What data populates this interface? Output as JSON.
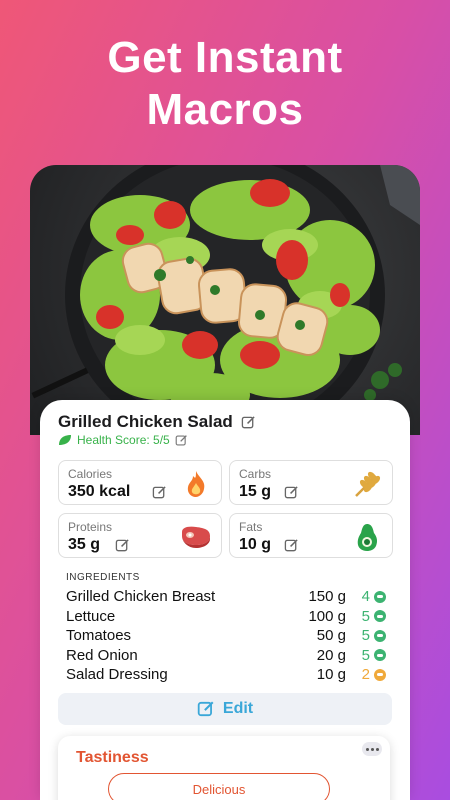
{
  "headline": {
    "line1": "Get Instant",
    "line2": "Macros"
  },
  "dish": {
    "name": "Grilled Chicken Salad",
    "health_score": "Health Score: 5/5"
  },
  "macros": [
    {
      "label": "Calories",
      "value": "350 kcal",
      "icon": "flame-icon"
    },
    {
      "label": "Carbs",
      "value": "15 g",
      "icon": "wheat-icon"
    },
    {
      "label": "Proteins",
      "value": "35 g",
      "icon": "steak-icon"
    },
    {
      "label": "Fats",
      "value": "10 g",
      "icon": "avocado-icon"
    }
  ],
  "ingredients": {
    "title": "INGREDIENTS",
    "items": [
      {
        "name": "Grilled Chicken Breast",
        "amount": "150 g",
        "score": "4",
        "color": "#3cb371"
      },
      {
        "name": "Lettuce",
        "amount": "100 g",
        "score": "5",
        "color": "#3cb371"
      },
      {
        "name": "Tomatoes",
        "amount": "50 g",
        "score": "5",
        "color": "#3cb371"
      },
      {
        "name": "Red Onion",
        "amount": "20 g",
        "score": "5",
        "color": "#3cb371"
      },
      {
        "name": "Salad Dressing",
        "amount": "10 g",
        "score": "2",
        "color": "#f0a93a"
      }
    ]
  },
  "edit_button": {
    "label": "Edit"
  },
  "tastiness": {
    "title": "Tastiness",
    "selected": "Delicious"
  },
  "colors": {
    "accent_blue": "#3aa7d8",
    "health_green": "#38b24a",
    "taste_orange": "#e25532"
  }
}
